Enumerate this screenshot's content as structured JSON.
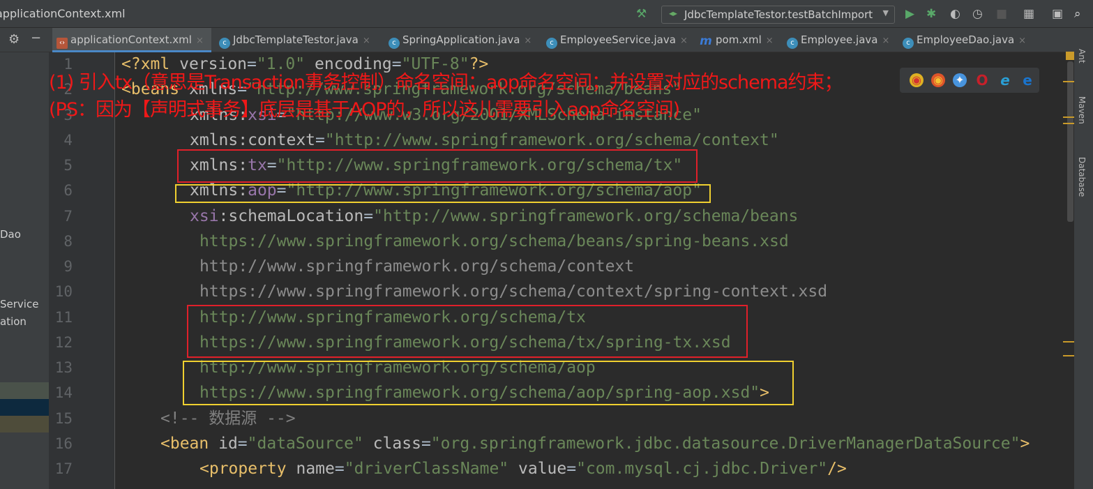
{
  "window": {
    "title": "applicationContext.xml"
  },
  "toolbar": {
    "run_config": "JdbcTemplateTestor.testBatchImport"
  },
  "tabs": [
    {
      "label": "applicationContext.xml",
      "icon": "xml-file-icon",
      "active": true
    },
    {
      "label": "JdbcTemplateTestor.java",
      "icon": "java-class-icon"
    },
    {
      "label": "SpringApplication.java",
      "icon": "java-class-icon"
    },
    {
      "label": "EmployeeService.java",
      "icon": "java-class-icon"
    },
    {
      "label": "pom.xml",
      "icon": "maven-icon"
    },
    {
      "label": "Employee.java",
      "icon": "java-class-icon"
    },
    {
      "label": "EmployeeDao.java",
      "icon": "java-class-icon"
    }
  ],
  "left_panel": {
    "items": [
      "Dao",
      "Service",
      "ation"
    ]
  },
  "right_tools": [
    "Ant",
    "Maven",
    "Database"
  ],
  "annotations": {
    "line1": "(1) 引入tx（意思是Transaction事务控制）命名空间；aop命名空间；并设置对应的schema约束；",
    "line2": "(PS：因为【声明式事务】底层是基于AOP的，所以这儿需要引入aop命名空间)"
  },
  "code": [
    {
      "n": "1",
      "indent": 0,
      "tokens": [
        [
          "t",
          "<?xml "
        ],
        [
          "a",
          "version"
        ],
        [
          "p",
          "="
        ],
        [
          "v",
          "\"1.0\""
        ],
        [
          "p",
          " "
        ],
        [
          "a",
          "encoding"
        ],
        [
          "p",
          "="
        ],
        [
          "v",
          "\"UTF-8\""
        ],
        [
          "t",
          "?>"
        ]
      ]
    },
    {
      "n": "2",
      "indent": 0,
      "tokens": [
        [
          "t",
          "<beans "
        ],
        [
          "a",
          "xmlns"
        ],
        [
          "p",
          "="
        ],
        [
          "v",
          "\"http://www.springframework.org/schema/beans\""
        ]
      ]
    },
    {
      "n": "3",
      "indent": 7,
      "tokens": [
        [
          "a",
          "xmlns:"
        ],
        [
          "ns",
          "xsi"
        ],
        [
          "p",
          "="
        ],
        [
          "v",
          "\"http://www.w3.org/2001/XMLSchema-instance\""
        ]
      ]
    },
    {
      "n": "4",
      "indent": 7,
      "tokens": [
        [
          "a",
          "xmlns:context"
        ],
        [
          "p",
          "="
        ],
        [
          "v",
          "\"http://www.springframework.org/schema/context\""
        ]
      ]
    },
    {
      "n": "5",
      "indent": 7,
      "tokens": [
        [
          "a",
          "xmlns:"
        ],
        [
          "ns",
          "tx"
        ],
        [
          "p",
          "="
        ],
        [
          "v",
          "\"http://www.springframework.org/schema/tx\""
        ]
      ]
    },
    {
      "n": "6",
      "indent": 7,
      "tokens": [
        [
          "a",
          "xmlns:"
        ],
        [
          "ns",
          "aop"
        ],
        [
          "p",
          "="
        ],
        [
          "v",
          "\"http://www.springframework.org/schema/aop\""
        ]
      ]
    },
    {
      "n": "7",
      "indent": 7,
      "tokens": [
        [
          "ns",
          "xsi"
        ],
        [
          "a",
          ":schemaLocation"
        ],
        [
          "p",
          "="
        ],
        [
          "v",
          "\"http://www.springframework.org/schema/beans"
        ]
      ]
    },
    {
      "n": "8",
      "indent": 8,
      "tokens": [
        [
          "v",
          "https://www.springframework.org/schema/beans/spring-beans.xsd"
        ]
      ]
    },
    {
      "n": "9",
      "indent": 8,
      "tokens": [
        [
          "g",
          "http://www.springframework.org/schema/context"
        ]
      ]
    },
    {
      "n": "10",
      "indent": 8,
      "tokens": [
        [
          "g",
          "https://www.springframework.org/schema/context/spring-context.xsd"
        ]
      ]
    },
    {
      "n": "11",
      "indent": 8,
      "tokens": [
        [
          "v",
          "http://www.springframework.org/schema/tx"
        ]
      ]
    },
    {
      "n": "12",
      "indent": 8,
      "tokens": [
        [
          "v",
          "https://www.springframework.org/schema/tx/spring-tx.xsd"
        ]
      ]
    },
    {
      "n": "13",
      "indent": 8,
      "tokens": [
        [
          "v",
          "http://www.springframework.org/schema/aop"
        ]
      ]
    },
    {
      "n": "14",
      "indent": 8,
      "tokens": [
        [
          "v",
          "https://www.springframework.org/schema/aop/spring-aop.xsd\""
        ],
        [
          "t",
          ">"
        ]
      ]
    },
    {
      "n": "15",
      "indent": 4,
      "tokens": [
        [
          "c",
          "<!-- 数据源 -->"
        ]
      ]
    },
    {
      "n": "16",
      "indent": 4,
      "tokens": [
        [
          "t",
          "<bean "
        ],
        [
          "a",
          "id"
        ],
        [
          "p",
          "="
        ],
        [
          "v",
          "\"dataSource\""
        ],
        [
          "p",
          " "
        ],
        [
          "a",
          "class"
        ],
        [
          "p",
          "="
        ],
        [
          "v",
          "\"org.springframework.jdbc.datasource.DriverManagerDataSource\""
        ],
        [
          "t",
          ">"
        ]
      ]
    },
    {
      "n": "17",
      "indent": 8,
      "tokens": [
        [
          "t",
          "<property "
        ],
        [
          "a",
          "name"
        ],
        [
          "p",
          "="
        ],
        [
          "v",
          "\"driverClassName\""
        ],
        [
          "p",
          " "
        ],
        [
          "a",
          "value"
        ],
        [
          "p",
          "="
        ],
        [
          "v",
          "\"com.mysql.cj.jdbc.Driver\""
        ],
        [
          "t",
          "/>"
        ]
      ]
    }
  ]
}
